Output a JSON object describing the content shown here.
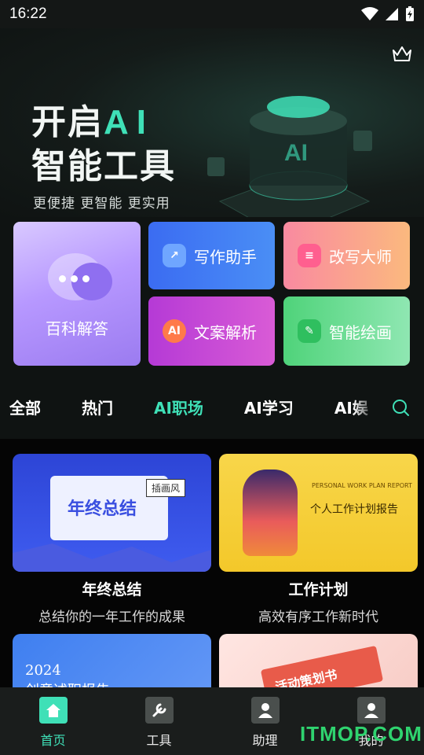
{
  "status_bar": {
    "time": "16:22",
    "icons": [
      "wifi-icon",
      "signal-icon",
      "battery-charging-icon"
    ]
  },
  "hero": {
    "title_line1_prefix": "开启",
    "title_line1_ai": "AI",
    "title_line2": "智能工具",
    "subtitle": "更便捷 更智能 更实用",
    "art_label": "AI",
    "vip_icon": "crown-icon"
  },
  "tools": {
    "baike": "百科解答",
    "xiezuo": "写作助手",
    "gaixie": "改写大师",
    "wenan": "文案解析",
    "huihua": "智能绘画"
  },
  "categories": [
    "全部",
    "热门",
    "AI职场",
    "AI学习",
    "AI娱"
  ],
  "active_category": "AI职场",
  "cards": [
    {
      "title": "年终总结",
      "desc": "总结你的一年工作的成果",
      "thumb_text": "年终总结",
      "thumb_tag": "插画风"
    },
    {
      "title": "工作计划",
      "desc": "高效有序工作新时代",
      "thumb_en": "PERSONAL WORK PLAN REPORT",
      "thumb_cn": "个人工作计划报告"
    },
    {
      "title": "",
      "desc": "",
      "thumb_year": "2024",
      "thumb_name": "创意述职报告"
    },
    {
      "title": "",
      "desc": "",
      "thumb_text": "活动策划书"
    }
  ],
  "tabs": [
    {
      "label": "首页",
      "icon": "home-icon"
    },
    {
      "label": "工具",
      "icon": "wrench-icon"
    },
    {
      "label": "助理",
      "icon": "assistant-icon"
    },
    {
      "label": "我的",
      "icon": "profile-icon"
    }
  ],
  "watermark": "ITMOP.COM"
}
